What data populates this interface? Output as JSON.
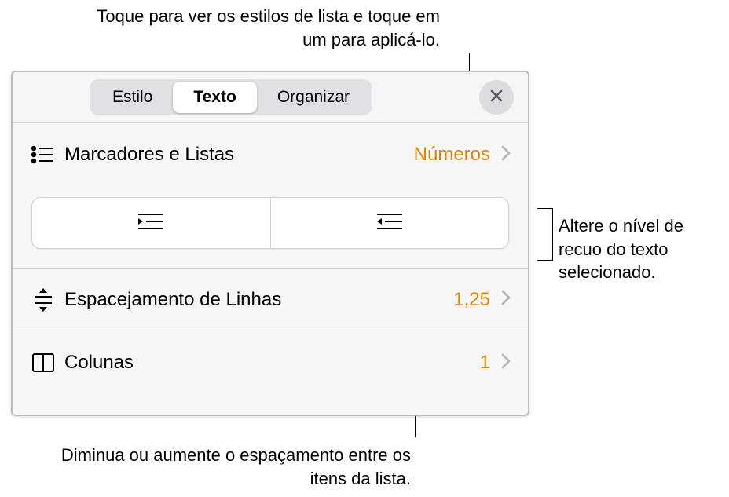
{
  "callouts": {
    "top": "Toque para ver os estilos de lista e toque em um para aplicá-lo.",
    "right": "Altere o nível de recuo do texto selecionado.",
    "bottom": "Diminua ou aumente o espaçamento entre os itens da lista."
  },
  "tabs": {
    "style": "Estilo",
    "text": "Texto",
    "arrange": "Organizar"
  },
  "rows": {
    "bullets": {
      "label": "Marcadores e Listas",
      "value": "Números"
    },
    "lineSpacing": {
      "label": "Espacejamento de Linhas",
      "value": "1,25"
    },
    "columns": {
      "label": "Colunas",
      "value": "1"
    }
  }
}
